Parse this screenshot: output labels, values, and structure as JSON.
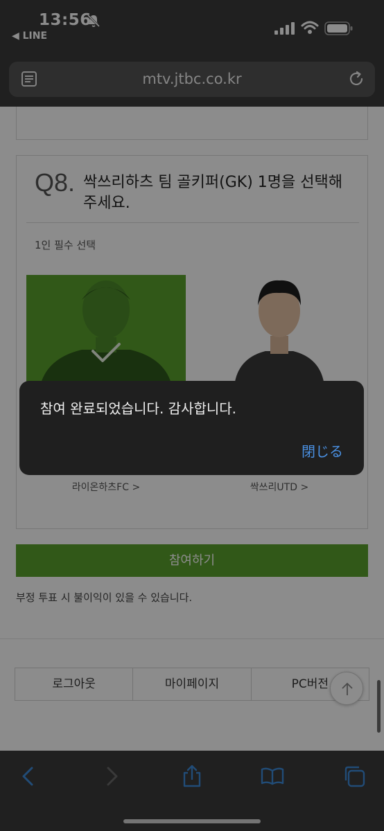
{
  "status_bar": {
    "time": "13:56",
    "back_app": "◀ LINE"
  },
  "browser": {
    "url": "mtv.jtbc.co.kr"
  },
  "question": {
    "number": "Q8.",
    "title": "싹쓰리하츠 팀 골키퍼(GK) 1명을 선택해 주세요.",
    "hint": "1인 필수 선택"
  },
  "players": [
    {
      "team_label": "라이온하츠FC >",
      "selected": true
    },
    {
      "team_label": "싹쓰리UTD >",
      "selected": false
    }
  ],
  "submit_label": "참여하기",
  "warning": "부정 투표 시 불이익이 있을 수 있습니다.",
  "footer_nav": [
    "로그아웃",
    "마이페이지",
    "PC버전"
  ],
  "alert": {
    "message": "참여 완료되었습니다. 감사합니다.",
    "close_label": "閉じる"
  },
  "colors": {
    "accent_green": "#5aa02d",
    "ios_blue": "#4a90e2"
  }
}
